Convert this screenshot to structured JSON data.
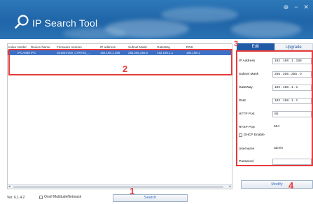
{
  "app": {
    "title": "IP Search Tool",
    "window_controls": [
      "⊕",
      "−",
      "✕"
    ]
  },
  "table": {
    "columns": [
      "Index",
      "Model",
      "Device Name",
      "Firmware Version",
      "IP address",
      "Subnet Mask",
      "GateWay",
      "DNS"
    ],
    "rows": [
      [
        "1",
        "IPCAMERA",
        "IPC",
        "3518EV200_CVR752_...",
        "192.168.1.168",
        "255.255.255.0",
        "192.168.1.1",
        "192.168.1"
      ]
    ],
    "selected_row_color": "#3c70c6"
  },
  "bottom": {
    "version": "Ver. 6.1.4.2",
    "onvif_label": "Onvif MultitudeNetmask",
    "search_label": "Search"
  },
  "panel": {
    "tabs": [
      "Edit",
      "Upgrade"
    ],
    "active_tab": "Edit",
    "fields": {
      "ip_label": "IP Address",
      "ip_value": "192 . 168 . 1 . 168",
      "mask_label": "Subnet Mask",
      "mask_value": "255 . 255 . 255 . 0",
      "gw_label": "GateWay",
      "gw_value": "192 . 168 . 1 . 1",
      "dns_label": "DNS",
      "dns_value": "192 . 168 . 1 . 1",
      "http_label": "HTTP Port",
      "http_value": "80",
      "rtsp_label": "RTSP Port",
      "rtsp_value": "554",
      "dhcp_label": "DHCP Enable",
      "user_label": "Username",
      "user_value": "admin",
      "pass_label": "Password",
      "pass_value": ""
    },
    "modify_label": "Modify"
  },
  "annotations": {
    "n1": "1",
    "n2": "2",
    "n3": "3",
    "n4": "4",
    "color": "#e53a3a"
  },
  "colors": {
    "header_bg": "#1f65a8",
    "accent": "#1f5aa6"
  }
}
